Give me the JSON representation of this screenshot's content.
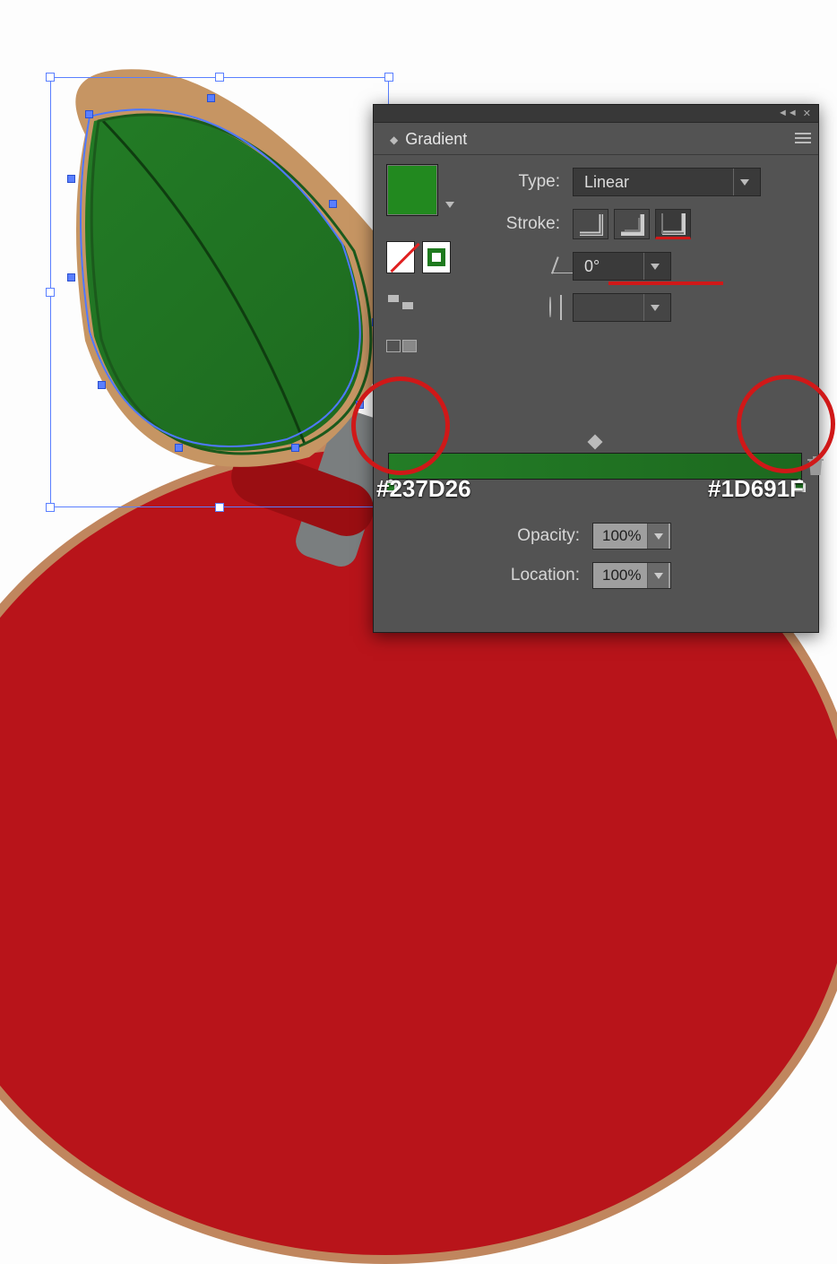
{
  "panel": {
    "title": "Gradient",
    "type_label": "Type:",
    "type_value": "Linear",
    "stroke_label": "Stroke:",
    "angle_value": "0°",
    "opacity_label": "Opacity:",
    "opacity_value": "100%",
    "location_label": "Location:",
    "location_value": "100%"
  },
  "gradient": {
    "stop_left_hex": "#237D26",
    "stop_right_hex": "#1D691F"
  },
  "colors": {
    "swatch": "#22891f",
    "apple": "#b8141a",
    "outline": "#c69563"
  }
}
